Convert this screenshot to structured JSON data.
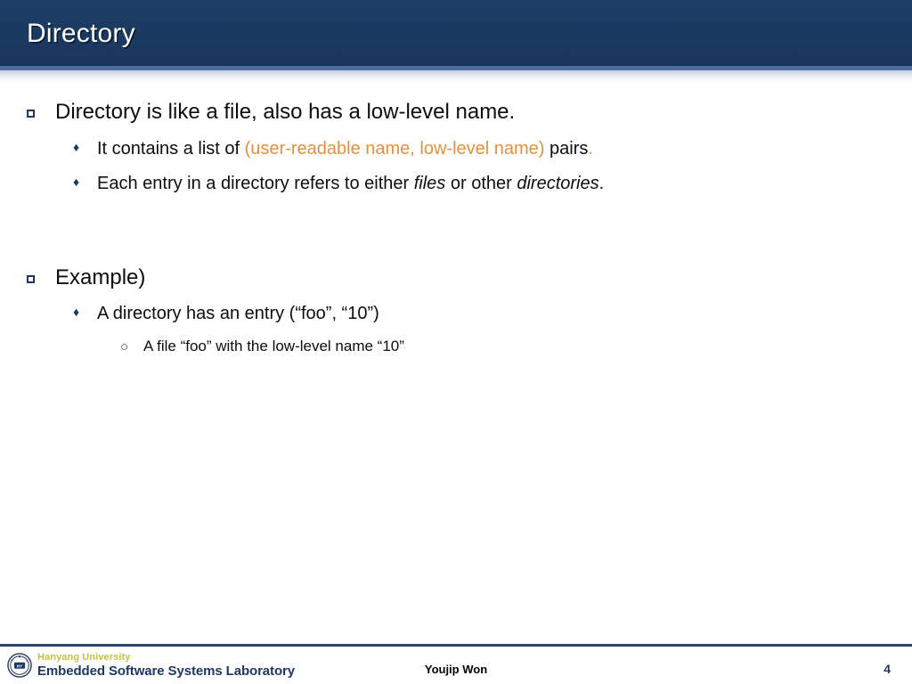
{
  "slide": {
    "title": "Directory",
    "colors": {
      "banner": "#1b3a62",
      "banner_accent": "#4a6d9e",
      "bullet_navy": "#1f3864",
      "highlight_orange": "#e2913f",
      "logo_yellow": "#c2c244",
      "body_text": "#0d0d0d"
    },
    "bullets": [
      {
        "level": 1,
        "marker": "hollow-square",
        "text": "Directory is like a file, also has a low-level name."
      },
      {
        "level": 2,
        "marker": "diamond",
        "segments": [
          {
            "text": "It contains a list of ",
            "style": "normal"
          },
          {
            "text": "(user-readable name, low-level name)",
            "style": "orange"
          },
          {
            "text": " pairs",
            "style": "normal"
          },
          {
            "text": ".",
            "style": "orange"
          }
        ]
      },
      {
        "level": 2,
        "marker": "diamond",
        "segments": [
          {
            "text": "Each entry in a directory refers to either ",
            "style": "normal"
          },
          {
            "text": "files",
            "style": "italic"
          },
          {
            "text": " or other ",
            "style": "normal"
          },
          {
            "text": "directories",
            "style": "italic"
          },
          {
            "text": ".",
            "style": "normal"
          }
        ]
      },
      {
        "level": 1,
        "marker": "hollow-square",
        "text": "Example)"
      },
      {
        "level": 2,
        "marker": "diamond",
        "text": "A directory has an entry (“foo”, “10”)"
      },
      {
        "level": 3,
        "marker": "hollow-circle",
        "text": "A file “foo” with the low-level name “10”"
      }
    ],
    "markers": {
      "diamond_glyph": "♦",
      "circle_glyph": "○"
    }
  },
  "footer": {
    "logo": {
      "university": "Hanyang University",
      "lab": "Embedded Software Systems Laboratory",
      "seal_alt": "university-seal"
    },
    "author": "Youjip Won",
    "page_number": "4"
  }
}
